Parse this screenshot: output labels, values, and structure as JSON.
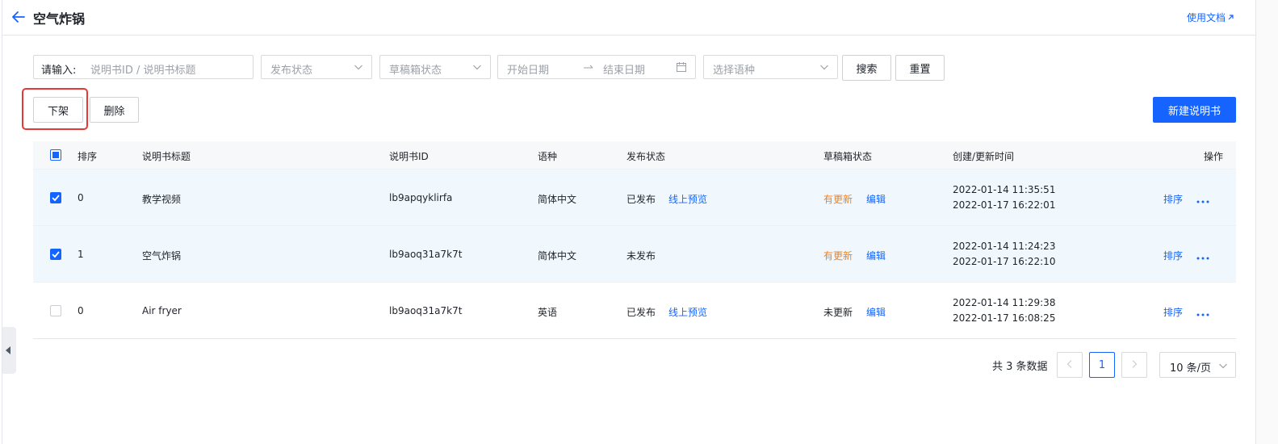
{
  "header": {
    "title": "空气炸锅",
    "doc_link": "使用文档"
  },
  "filters": {
    "input_label": "请输入:",
    "input_placeholder": "说明书ID / 说明书标题",
    "publish_status_placeholder": "发布状态",
    "draft_status_placeholder": "草稿箱状态",
    "start_date_placeholder": "开始日期",
    "end_date_placeholder": "结束日期",
    "language_placeholder": "选择语种",
    "search_label": "搜索",
    "reset_label": "重置"
  },
  "actions": {
    "offline_label": "下架",
    "delete_label": "删除",
    "new_label": "新建说明书"
  },
  "table": {
    "columns": {
      "order": "排序",
      "title": "说明书标题",
      "id": "说明书ID",
      "language": "语种",
      "publish_status": "发布状态",
      "draft_status": "草稿箱状态",
      "time": "创建/更新时间",
      "actions": "操作"
    },
    "rows": [
      {
        "selected": true,
        "order": "0",
        "title": "教学视频",
        "id": "lb9apqyklirfa",
        "language": "简体中文",
        "publish_status": "已发布",
        "preview": "线上预览",
        "draft_status": "有更新",
        "edit": "编辑",
        "created": "2022-01-14 11:35:51",
        "updated": "2022-01-17 16:22:01",
        "sort": "排序"
      },
      {
        "selected": true,
        "order": "1",
        "title": "空气炸锅",
        "id": "lb9aoq31a7k7t",
        "language": "简体中文",
        "publish_status": "未发布",
        "preview": "",
        "draft_status": "有更新",
        "edit": "编辑",
        "created": "2022-01-14 11:24:23",
        "updated": "2022-01-17 16:22:10",
        "sort": "排序"
      },
      {
        "selected": false,
        "order": "0",
        "title": "Air fryer",
        "id": "lb9aoq31a7k7t",
        "language": "英语",
        "publish_status": "已发布",
        "preview": "线上预览",
        "draft_status": "未更新",
        "edit": "编辑",
        "created": "2022-01-14 11:29:38",
        "updated": "2022-01-17 16:08:25",
        "sort": "排序"
      }
    ]
  },
  "pagination": {
    "total": "共 3 条数据",
    "current_page": "1",
    "page_size": "10 条/页"
  },
  "colors": {
    "accent": "#1664ff",
    "warning": "#f57f17",
    "highlight": "#e53935",
    "selected_row": "#f1f8fd"
  }
}
